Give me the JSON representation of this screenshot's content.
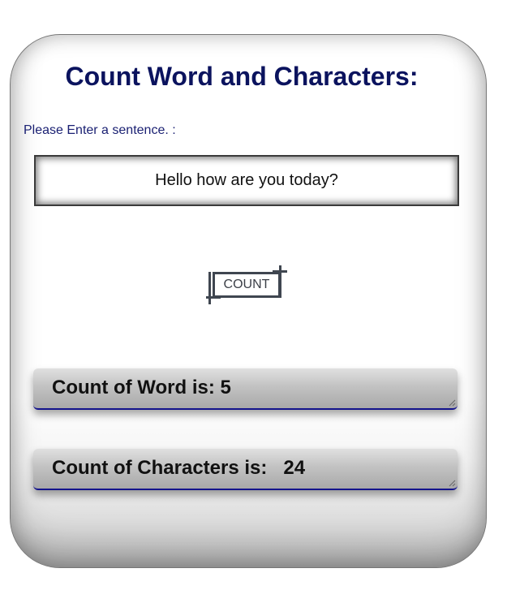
{
  "title": "Count Word and Characters:",
  "prompt": "Please Enter a sentence. :",
  "input": {
    "value": "Hello how are you today?",
    "placeholder": ""
  },
  "button": {
    "label": "COUNT"
  },
  "results": {
    "words_label": "Count of Word is: ",
    "words_value": "5",
    "chars_label": "Count of Characters is:   ",
    "chars_value": "24"
  },
  "colors": {
    "title": "#0b135e",
    "prompt": "#1b2173",
    "result_border": "#14148c"
  }
}
